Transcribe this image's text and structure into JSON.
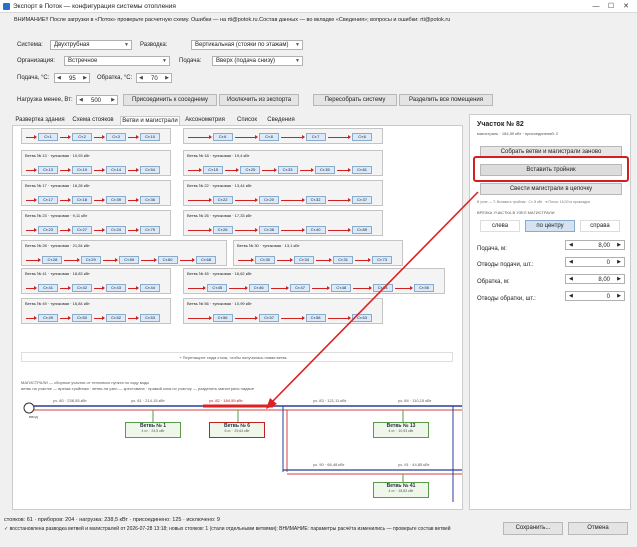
{
  "window": {
    "title": "Экспорт в Поток — конфигурация системы отопления",
    "minimize": "—",
    "maximize": "☐",
    "close": "✕"
  },
  "banner": "ВНИМАНИЕ!! После загрузки в «Поток» проверьте расчетную схему. Ошибки — на rti@potok.ru.Состав данных — во вкладке «Сведения»; вопросы и ошибки: rti@potok.ru",
  "form": {
    "system_label": "Система:",
    "system_value": "Двухтрубная",
    "routing_label": "Разводка:",
    "routing_value": "Вертикальная (стояки по этажам)",
    "org_label": "Организация:",
    "org_value": "Встречное",
    "feed_label": "Подача:",
    "feed_value": "Вверх (подача снизу)",
    "supply_temp_label": "Подача, °С:",
    "supply_temp_value": "95",
    "return_temp_label": "Обратка, °С:",
    "return_temp_value": "70",
    "load_label": "Нагрузка менее, Вт:",
    "load_value": "500"
  },
  "actions": {
    "attach": "Присоединить к соседнему",
    "exclude": "Исключить из экспорта",
    "recount": "Пересобрать систему",
    "split": "Разделить все помещения"
  },
  "tabs": [
    "Развертка здания",
    "Схема стояков",
    "Ветви и магистрали",
    "Аксонометрия",
    "Список",
    "Сведения"
  ],
  "branches_grid": [
    {
      "title": "",
      "risers": [
        "Ст.1",
        "Ст.2",
        "Ст.3",
        "Ст.10"
      ]
    },
    {
      "title": "",
      "risers": [
        "Ст.6",
        "Ст.8",
        "Ст.7",
        "Ст.6"
      ]
    },
    {
      "title": "Ветвь № 13 · тупиковая · 10,93 кВт",
      "risers": [
        "Ст.13",
        "Ст.19",
        "Ст.14",
        "Ст.54"
      ]
    },
    {
      "title": "Ветвь № 18 · тупиковая · 19,4 кВт",
      "risers": [
        "Ст.15",
        "Ст.25",
        "Ст.33",
        "Ст.35",
        "Ст.81"
      ]
    },
    {
      "title": "Ветвь № 17 · тупиковая · 16,28 кВт",
      "risers": [
        "Ст.17",
        "Ст.18",
        "Ст.39",
        "Ст.36"
      ]
    },
    {
      "title": "Ветвь № 22 · тупиковая · 13,44 кВт",
      "risers": [
        "Ст.22",
        "Ст.20",
        "Ст.32",
        "Ст.37"
      ]
    },
    {
      "title": "Ветвь № 23 · тупиковая · 9,11 кВт",
      "risers": [
        "Ст.23",
        "Ст.27",
        "Ст.24",
        "Ст.79"
      ]
    },
    {
      "title": "Ветвь № 26 · тупиковая · 17,33 кВт",
      "risers": [
        "Ст.26",
        "Ст.38",
        "Ст.40",
        "Ст.89"
      ]
    },
    {
      "title": "Ветвь № 28 · тупиковая · 21,54 кВт",
      "risers": [
        "Ст.28",
        "Ст.29",
        "Ст.59",
        "Ст.60",
        "Ст.68"
      ]
    },
    {
      "title": "Ветвь № 30 · тупиковая · 13,1 кВт",
      "risers": [
        "Ст.30",
        "Ст.34",
        "Ст.31",
        "Ст.73"
      ]
    },
    {
      "title": "Ветвь № 41 · тупиковая · 18,83 кВт",
      "risers": [
        "Ст.41",
        "Ст.42",
        "Ст.43",
        "Ст.44"
      ]
    },
    {
      "title": "Ветвь № 45 · тупиковая · 16,62 кВт",
      "risers": [
        "Ст.45",
        "Ст.46",
        "Ст.47",
        "Ст.48",
        "Ст.54",
        "Ст.55"
      ]
    },
    {
      "title": "Ветвь № 49 · тупиковая · 16,84 кВт",
      "risers": [
        "Ст.49",
        "Ст.50",
        "Ст.52",
        "Ст.53"
      ]
    },
    {
      "title": "Ветвь № 56 · тупиковая · 10,99 кВт",
      "risers": [
        "Ст.56",
        "Ст.57",
        "Ст.58",
        "Ст.63"
      ]
    }
  ],
  "drag_hint": "+ Перетащите сюда стояк, чтобы получилась новая ветвь",
  "mains_legend_1": "МАГИСТРАЛИ — сборные участки от теплового пункта по ходу воды",
  "mains_legend_2": "ветвь на участке — врезка тройника · ветвь на узел — крестовина · правый клик по участку — разделить магистраль надвое",
  "mains": {
    "input_label": "ввод",
    "seg1": "уч. 80 · 238,55 кВт",
    "seg2": "уч. 81 · 214,15 кВт",
    "seg3": "уч. 82 · 184,59 кВт",
    "seg4": "уч. 83 · 121,11 кВт",
    "seg5": "уч. 84 · 110,15 кВт",
    "seg6": "уч. 90 · 66,48 кВт",
    "seg7": "уч. 91 · 44,85 кВт",
    "branches": [
      {
        "name": "Ветвь № 1",
        "sub": "4 ст. · 24,5 кВт"
      },
      {
        "name": "Ветвь № 6",
        "sub": "5 ст. · 29,64 кВт"
      },
      {
        "name": "Ветвь № 13",
        "sub": "4 ст. · 10,93 кВт"
      },
      {
        "name": "Ветвь № 41",
        "sub": "4 ст. · 18,83 кВт"
      }
    ]
  },
  "right_panel": {
    "title": "Участок № 82",
    "subtitle": "магистраль · 184,59 кВт · присоединений: 2",
    "collect_btn": "Собрать ветви и магистрали заново",
    "insert_tee_btn": "Вставить тройник",
    "chain_btn": "Свести магистрали в цепочку",
    "note": "В узле — T: Вставить тройник · Ст. 8 кВт · в Поток: 16,00 м прокладка",
    "tee_section": "ВРЕЗКА УЧАСТКА В УЗЕЛ МАГИСТРАЛИ",
    "seg_left": "слева",
    "seg_center": "по центру",
    "seg_right": "справа",
    "supply_len_label": "Подача, м:",
    "supply_len_value": "8,00",
    "supply_taps_label": "Отводы подачи, шт.:",
    "supply_taps_value": "0",
    "return_len_label": "Обратка, м:",
    "return_len_value": "8,00",
    "return_taps_label": "Отводы обратки, шт.:",
    "return_taps_value": "0"
  },
  "status": {
    "line1": "стояков: 61 · приборов: 204 · нагрузка: 238,5 кВт · присоединено: 125 · исключено: 9",
    "line2": "✓ восстановлена разводка ветвей и магистралей от 2026-07-28 13:18; новых стояков: 1 (стали отдельными ветвями); ВНИМАНИЕ: параметры расчёта изменились — проверьте состав ветвей",
    "save_btn": "Сохранить...",
    "cancel_btn": "Отмена"
  },
  "colors": {
    "accent": "#d02020",
    "riser_fill": "#dbe9f8",
    "branch_fill": "#eef7ea",
    "supply_line": "#2a3f9c",
    "return_line": "#d04040"
  }
}
